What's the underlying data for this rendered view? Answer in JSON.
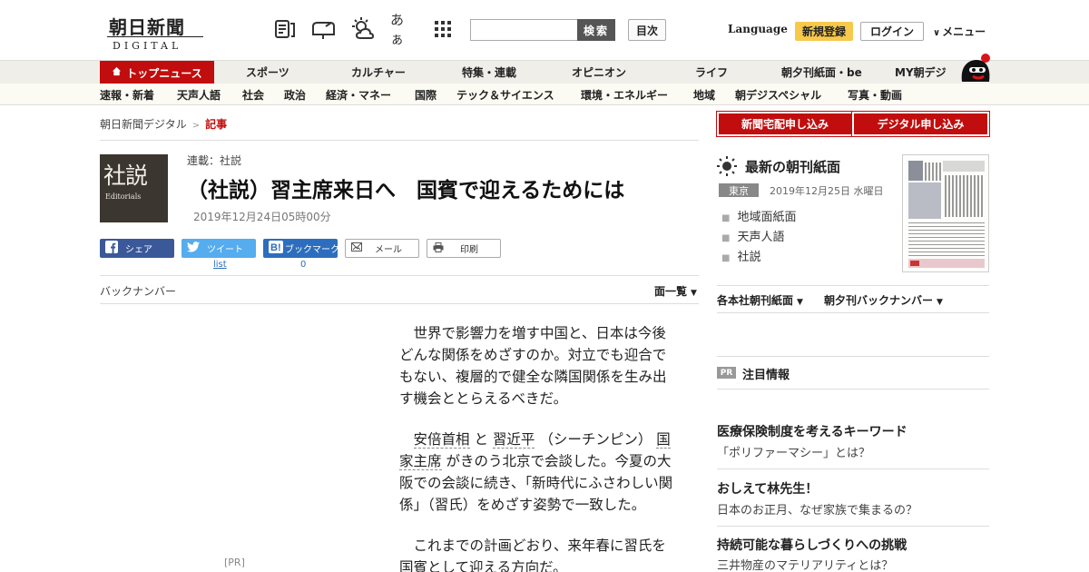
{
  "header": {
    "logo_jp": "朝日新聞",
    "logo_en": "DIGITAL",
    "icons": [
      "newspaper-icon",
      "mailbox-icon",
      "weather-icon",
      "font-size-icon",
      "grid-menu-icon"
    ],
    "font_icon_text": "あぁ",
    "search_placeholder": "",
    "search_button": "検索",
    "toc_button": "目次",
    "language": "Language",
    "register": "新規登録",
    "login": "ログイン",
    "menu": "メニュー"
  },
  "nav_primary": {
    "items": [
      "トップニュース",
      "スポーツ",
      "カルチャー",
      "特集・連載",
      "オピニオン",
      "ライフ",
      "朝夕刊紙面・be",
      "MY朝デジ"
    ],
    "active_color": "#c10d0d"
  },
  "nav_secondary": {
    "items": [
      "速報・新着",
      "天声人語",
      "社会",
      "政治",
      "経済・マネー",
      "国際",
      "テック＆サイエンス",
      "環境・エネルギー",
      "地域",
      "朝デジスペシャル",
      "写真・動画"
    ]
  },
  "breadcrumb": {
    "home": "朝日新聞デジタル",
    "sep": ">",
    "current": "記事"
  },
  "article": {
    "logo_big": "社説",
    "logo_small": "Editorials",
    "series": "連載：社説",
    "headline": "（社説）習主席来日へ　国賓で迎えるためには",
    "date": "2019年12月24日05時00分",
    "share": {
      "facebook": "シェア",
      "twitter": "ツイート",
      "hatena": "ブックマーク",
      "mail": "メール",
      "print": "印刷",
      "twitter_count": "list",
      "hatena_count": "0"
    },
    "back_numbers": "バックナンバー",
    "list_menu": "面一覧",
    "pr": "[PR]",
    "p1": "世界で影響力を増す中国と、日本は今後どんな関係をめざすのか。対立でも迎合でもない、複層的で健全な隣国関係を生み出す機会ととらえるべきだ。",
    "p2_kw1": "安倍首相",
    "p2_t1": " と ",
    "p2_kw2": "習近平",
    "p2_t2": " （シーチンピン） ",
    "p2_kw3": "国家主席",
    "p2_t3": " がきのう北京で会談した。今夏の大阪での会談に続き、「新時代にふさわしい関係」（習氏）をめざす姿勢で一致した。",
    "p3": "これまでの計画どおり、来年春に習氏を国賓として迎える方向だ。"
  },
  "sidebar": {
    "home_delivery": "新聞宅配申し込み",
    "digital_signup": "デジタル申し込み",
    "paper_title": "最新の朝刊紙面",
    "region": "東京",
    "paper_date": "2019年12月25日 水曜日",
    "links": [
      "地域面紙面",
      "天声人語",
      "社説"
    ],
    "dropdowns": [
      "各本社朝刊紙面",
      "朝夕刊バックナンバー"
    ],
    "pr_badge": "PR",
    "notice_title": "注目情報",
    "promos": [
      {
        "title": "医療保険制度を考えるキーワード",
        "sub": "「ポリファーマシー」とは？"
      },
      {
        "title": "おしえて林先生！",
        "sub": "日本のお正月、なぜ家族で集まるの？"
      },
      {
        "title": "持続可能な暮らしづくりへの挑戦",
        "sub": "三井物産のマテリアリティとは？"
      }
    ]
  },
  "colors": {
    "brand_red": "#c10d0d",
    "register_yellow": "#f6c94b",
    "facebook": "#3b5998",
    "twitter": "#55acee",
    "hatena": "#2c6ebd"
  }
}
